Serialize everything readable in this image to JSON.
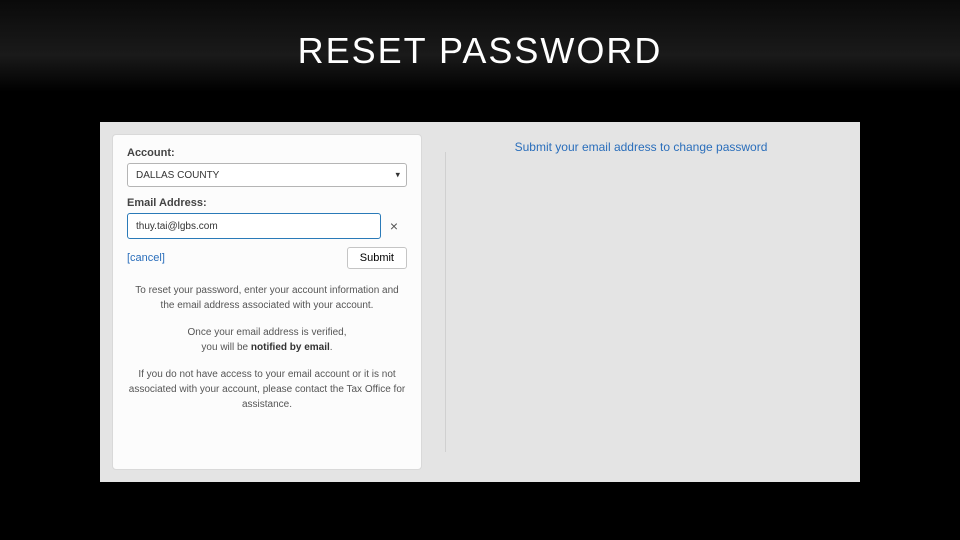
{
  "slide": {
    "title": "RESET PASSWORD"
  },
  "form": {
    "account_label": "Account:",
    "account_value": "DALLAS COUNTY",
    "email_label": "Email Address:",
    "email_value": "thuy.tai@lgbs.com",
    "clear_symbol": "×",
    "cancel_text": "[cancel]",
    "submit_text": "Submit"
  },
  "help": {
    "para1": "To reset your password, enter your account information and the email address associated with your account.",
    "para2a": "Once your email address is verified,",
    "para2b_prefix": "you will be ",
    "para2b_bold": "notified by email",
    "para2b_suffix": ".",
    "para3": "If you do not have access to your email account or it is not associated with your account, please contact the Tax Office for assistance."
  },
  "right": {
    "link_text": "Submit your email address to change password"
  }
}
